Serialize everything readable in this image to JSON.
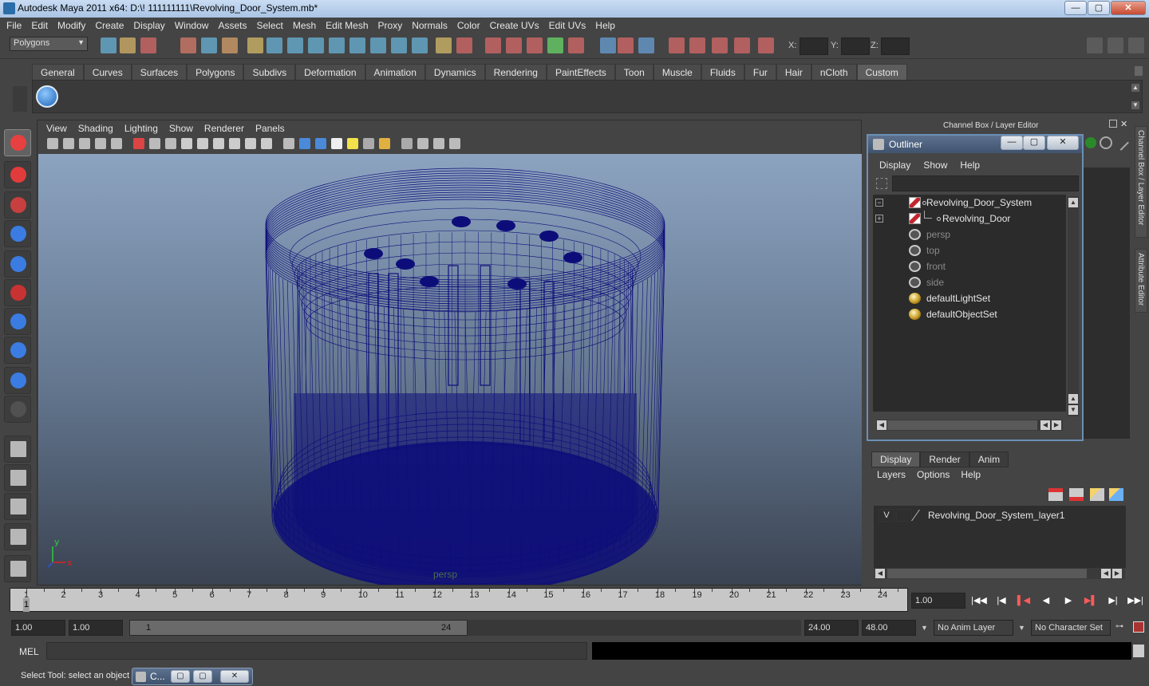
{
  "window": {
    "title": "Autodesk Maya 2011 x64: D:\\! 111111111\\Revolving_Door_System.mb*",
    "minimize": "—",
    "maximize": "▢",
    "close": "✕"
  },
  "menu": [
    "File",
    "Edit",
    "Modify",
    "Create",
    "Display",
    "Window",
    "Assets",
    "Select",
    "Mesh",
    "Edit Mesh",
    "Proxy",
    "Normals",
    "Color",
    "Create UVs",
    "Edit UVs",
    "Help"
  ],
  "status_line": {
    "mode": "Polygons",
    "x_label": "X:",
    "y_label": "Y:",
    "z_label": "Z:"
  },
  "shelf_tabs": [
    "General",
    "Curves",
    "Surfaces",
    "Polygons",
    "Subdivs",
    "Deformation",
    "Animation",
    "Dynamics",
    "Rendering",
    "PaintEffects",
    "Toon",
    "Muscle",
    "Fluids",
    "Fur",
    "Hair",
    "nCloth",
    "Custom"
  ],
  "active_shelf": "Custom",
  "viewport": {
    "menu": [
      "View",
      "Shading",
      "Lighting",
      "Show",
      "Renderer",
      "Panels"
    ],
    "camera_label": "persp",
    "axis_x": "x",
    "axis_y": "y",
    "wire_color": "#0d0d7a"
  },
  "channel_box_title": "Channel Box / Layer Editor",
  "side_tabs": [
    "Channel Box / Layer Editor",
    "Attribute Editor"
  ],
  "outliner": {
    "title": "Outliner",
    "menu": [
      "Display",
      "Show",
      "Help"
    ],
    "items": [
      {
        "label": "Revolving_Door_System",
        "type": "xform",
        "dim": false,
        "expand": "−"
      },
      {
        "label": "Revolving_Door",
        "type": "xform",
        "dim": false,
        "expand": "+"
      },
      {
        "label": "persp",
        "type": "cam",
        "dim": true,
        "expand": ""
      },
      {
        "label": "top",
        "type": "cam",
        "dim": true,
        "expand": ""
      },
      {
        "label": "front",
        "type": "cam",
        "dim": true,
        "expand": ""
      },
      {
        "label": "side",
        "type": "cam",
        "dim": true,
        "expand": ""
      },
      {
        "label": "defaultLightSet",
        "type": "set",
        "dim": false,
        "expand": ""
      },
      {
        "label": "defaultObjectSet",
        "type": "set",
        "dim": false,
        "expand": ""
      }
    ]
  },
  "layer_editor": {
    "tabs": [
      "Display",
      "Render",
      "Anim"
    ],
    "active_tab": "Display",
    "menu": [
      "Layers",
      "Options",
      "Help"
    ],
    "layers": [
      {
        "visible": "V",
        "name": "Revolving_Door_System_layer1"
      }
    ]
  },
  "time_slider": {
    "ticks": [
      "1",
      "2",
      "3",
      "4",
      "5",
      "6",
      "7",
      "8",
      "9",
      "10",
      "11",
      "12",
      "13",
      "14",
      "15",
      "16",
      "17",
      "18",
      "19",
      "20",
      "21",
      "22",
      "23",
      "24"
    ],
    "current_frame": "1",
    "current_time": "1.00"
  },
  "range_slider": {
    "start_time": "1.00",
    "playback_start": "1.00",
    "range_start_label": "1",
    "range_end_label": "24",
    "playback_end": "24.00",
    "end_time": "48.00",
    "anim_layer": "No Anim Layer",
    "character_set": "No Character Set"
  },
  "playback": [
    "|◀◀",
    "|◀",
    "▌◀",
    "◀",
    "▶",
    "▶▌",
    "▶|",
    "▶▶|"
  ],
  "command_line": {
    "label": "MEL"
  },
  "help_line": {
    "text": "Select Tool: select an object",
    "mini_window_title": "C..."
  }
}
